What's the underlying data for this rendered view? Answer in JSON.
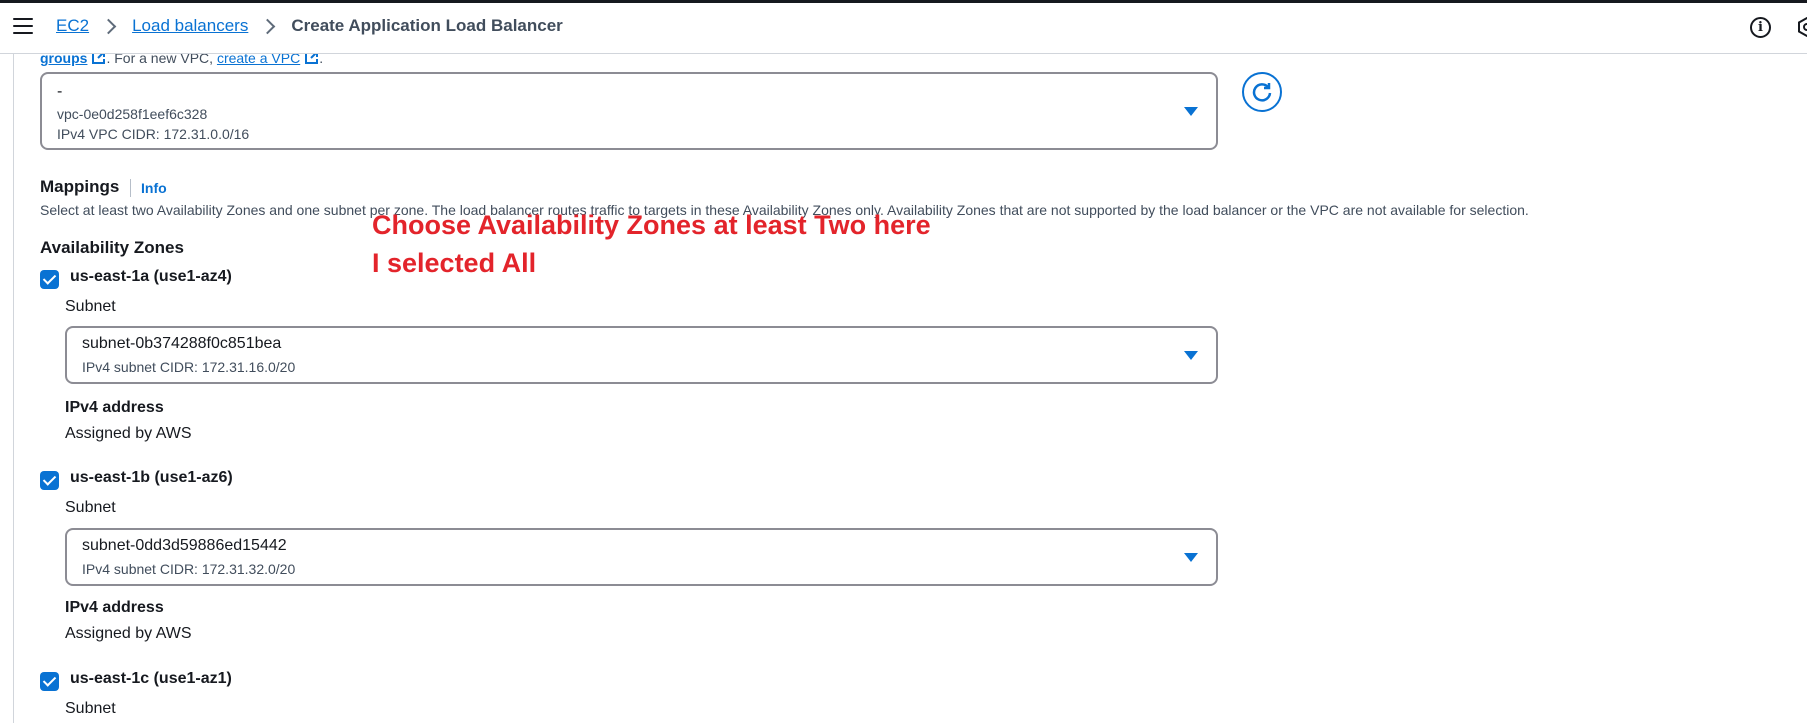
{
  "breadcrumb": {
    "items": [
      {
        "label": "EC2"
      },
      {
        "label": "Load balancers"
      },
      {
        "label": "Create Application Load Balancer"
      }
    ]
  },
  "header_icons": [
    "info-icon",
    "settings-icon"
  ],
  "vpc_section": {
    "help_link_1": "groups",
    "help_text": ". For a new VPC, ",
    "help_link_2": "create a VPC",
    "help_end": ".",
    "vpc_select": {
      "name": "-",
      "id": "vpc-0e0d258f1eef6c328",
      "cidr": "IPv4 VPC CIDR: 172.31.0.0/16"
    }
  },
  "mappings": {
    "title": "Mappings",
    "info_label": "Info",
    "description": "Select at least two Availability Zones and one subnet per zone. The load balancer routes traffic to targets in these Availability Zones only. Availability Zones that are not supported by the load balancer or the VPC are not available for selection.",
    "az_heading": "Availability Zones",
    "zones": [
      {
        "label": "us-east-1a (use1-az4)",
        "checked": true,
        "subnet_label": "Subnet",
        "subnet_id": "subnet-0b374288f0c851bea",
        "subnet_cidr": "IPv4 subnet CIDR: 172.31.16.0/20",
        "ipv4_title": "IPv4 address",
        "ipv4_value": "Assigned by AWS"
      },
      {
        "label": "us-east-1b (use1-az6)",
        "checked": true,
        "subnet_label": "Subnet",
        "subnet_id": "subnet-0dd3d59886ed15442",
        "subnet_cidr": "IPv4 subnet CIDR: 172.31.32.0/20",
        "ipv4_title": "IPv4 address",
        "ipv4_value": "Assigned by AWS"
      },
      {
        "label": "us-east-1c (use1-az1)",
        "checked": true,
        "subnet_label": "Subnet"
      }
    ]
  },
  "annotation": {
    "text": "Choose Availability Zones at least Two here I selected All",
    "color": "#e3242b"
  },
  "colors": {
    "link": "#0972d3",
    "border": "#8c8c94",
    "text": "#16191f"
  }
}
